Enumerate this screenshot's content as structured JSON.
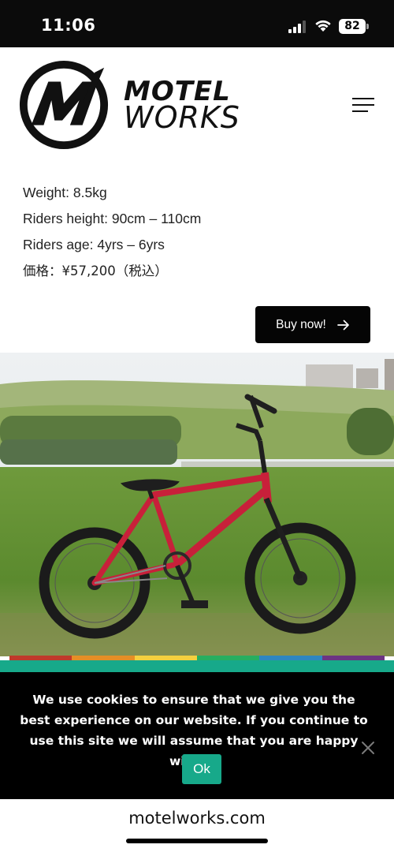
{
  "status_bar": {
    "time": "11:06",
    "battery": "82",
    "icons": [
      "signal-icon",
      "wifi-icon",
      "battery-icon"
    ]
  },
  "brand": {
    "line1": "MOTEL",
    "line2": "WORKS",
    "logo_icon": "motel-works-logo"
  },
  "header": {
    "menu_icon": "hamburger-menu-icon"
  },
  "specs": {
    "weight": "Weight: 8.5kg",
    "height": "Riders height: 90cm – 110cm",
    "age": "Riders age: 4yrs – 6yrs",
    "price": "価格：¥57,200（税込）"
  },
  "buy": {
    "label": "Buy now!",
    "icon": "arrow-right-icon"
  },
  "photo": {
    "subject": "red kids bicycle on grass",
    "frame_colors": [
      "#c0392b",
      "#e58e26",
      "#f4d03f",
      "#27ae60",
      "#2e86c1",
      "#6c3483"
    ]
  },
  "cookie": {
    "message": "We use cookies to ensure that we give you the best experience on our website. If you continue to use this site we will assume that you are happy with it.",
    "ok_label": "Ok",
    "close_icon": "close-icon",
    "accent": "#17a98a"
  },
  "browser": {
    "url": "motelworks.com"
  }
}
